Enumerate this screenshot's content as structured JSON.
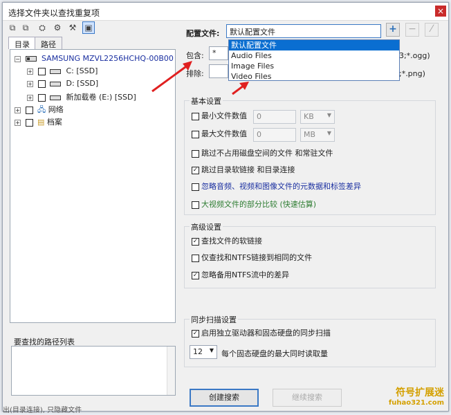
{
  "window": {
    "title": "选择文件夹以查找重复项",
    "close": "×"
  },
  "toolbar": {
    "icons": [
      "copy-icon",
      "copy2-icon",
      "network-icon",
      "users-icon",
      "scan-icon",
      "monitor-icon"
    ]
  },
  "tabs": [
    {
      "label": "目录"
    },
    {
      "label": "路径"
    }
  ],
  "tree": {
    "root": "SAMSUNG MZVL2256HCHQ-00B00",
    "drives": [
      {
        "label": "C: [SSD]"
      },
      {
        "label": "D: [SSD]"
      },
      {
        "label": "新加载卷 (E:) [SSD]"
      }
    ],
    "network": "网络",
    "archive": "档案"
  },
  "pathlist": {
    "label": "要查找的路径列表"
  },
  "config": {
    "label": "配置文件:",
    "value": "默认配置文件",
    "options": [
      "默认配置文件",
      "Audio Files",
      "Image Files",
      "Video Files"
    ],
    "include_label": "包含:",
    "include_value": "*",
    "include_tail": "p3;*.ogg)",
    "exclude_label": "排除:",
    "exclude_tail": "g;*.png)"
  },
  "basic": {
    "title": "基本设置",
    "min_label": "最小文件数值",
    "min_value": "0",
    "min_unit": "KB",
    "max_label": "最大文件数值",
    "max_value": "0",
    "max_unit": "MB",
    "opt1": "跳过不占用磁盘空间的文件 和常驻文件",
    "opt2": "跳过目录软链接 和目录连接",
    "opt3": "忽略音频、视频和图像文件的元数据和标签差异",
    "opt4": "大视频文件的部分比较 (快速估算)"
  },
  "advanced": {
    "title": "高级设置",
    "opt1": "查找文件的软链接",
    "opt2": "仅查找和NTFS链接到相同的文件",
    "opt3": "忽略备用NTFS流中的差异"
  },
  "sync": {
    "title": "同步扫描设置",
    "opt1": "启用独立驱动器和固态硬盘的同步扫描",
    "count": "12",
    "count_label": "每个固态硬盘的最大同时读取量"
  },
  "buttons": {
    "create": "创建搜索",
    "continue": "继续搜索"
  },
  "colors": {
    "accent": "#0a6ed1",
    "arrow": "#e02020"
  },
  "watermark": {
    "line1": "符号扩展迷",
    "line2": "fuhao321.com"
  },
  "bottom_text": "出(目录连接), 只隐藏文件"
}
